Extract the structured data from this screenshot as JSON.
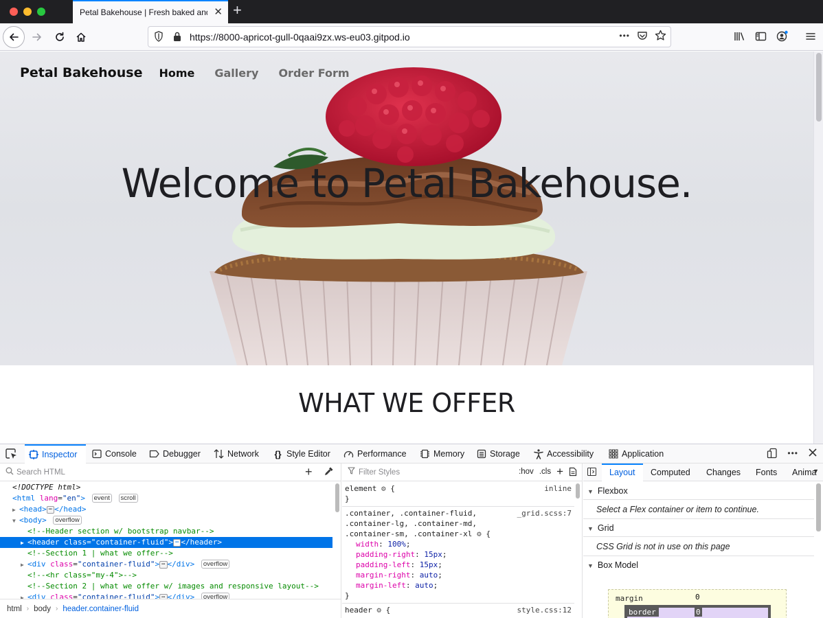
{
  "browser": {
    "tab_title": "Petal Bakehouse | Fresh baked and…",
    "tab_close": "✕",
    "new_tab": "+",
    "url": "https://8000-apricot-gull-0qaai9zx.ws-eu03.gitpod.io",
    "url_more": "•••"
  },
  "site": {
    "brand": "Petal Bakehouse",
    "nav": [
      "Home",
      "Gallery",
      "Order Form"
    ],
    "active_nav": "Home",
    "hero_title": "Welcome to Petal Bakehouse.",
    "section_title": "WHAT WE OFFER"
  },
  "devtools": {
    "tabs": [
      {
        "label": "Inspector",
        "icon": "inspector-icon"
      },
      {
        "label": "Console",
        "icon": "console-icon"
      },
      {
        "label": "Debugger",
        "icon": "debugger-icon"
      },
      {
        "label": "Network",
        "icon": "network-icon"
      },
      {
        "label": "Style Editor",
        "icon": "braces-icon"
      },
      {
        "label": "Performance",
        "icon": "gauge-icon"
      },
      {
        "label": "Memory",
        "icon": "memory-chip-icon"
      },
      {
        "label": "Storage",
        "icon": "storage-icon"
      },
      {
        "label": "Accessibility",
        "icon": "accessibility-icon"
      },
      {
        "label": "Application",
        "icon": "grid-dots-icon"
      }
    ],
    "selected_tab": "Inspector",
    "search_placeholder": "Search HTML",
    "markup": {
      "doctype": "<!DOCTYPE html>",
      "html_tag": "html",
      "html_attr": "lang",
      "html_val": "\"en\"",
      "badge_event": "event",
      "badge_scroll": "scroll",
      "head_tag": "head",
      "body_tag": "body",
      "badge_overflow": "overflow",
      "comment_header": "<!--Header section w/ bootstrap navbar-->",
      "header_tag": "header",
      "class_attr": "class",
      "header_class": "\"container-fluid\"",
      "comment_section1": "<!--Section 1 | what we offer-->",
      "div_tag": "div",
      "div_class": "\"container-fluid\"",
      "comment_hr": "<!--<hr class=\"my-4\">-->",
      "comment_section2": "<!--Section 2 | what we offer w/ images and responsive layout-->",
      "dots": "⋯"
    },
    "breadcrumbs": [
      "html",
      "body",
      "header.container-fluid"
    ],
    "filter_placeholder": "Filter Styles",
    "rules_toolbar": {
      "hov": ":hov",
      "cls": ".cls",
      "add": "+"
    },
    "rules": {
      "element_selector": "element",
      "element_src": "inline",
      "container_selector_1": ".container, .container-fluid,",
      "container_selector_2": ".container-lg, .container-md,",
      "container_selector_3": ".container-sm, .container-xl",
      "container_src": "_grid.scss:7",
      "props": [
        {
          "name": "width",
          "value": "100%"
        },
        {
          "name": "padding-right",
          "value": "15px"
        },
        {
          "name": "padding-left",
          "value": "15px"
        },
        {
          "name": "margin-right",
          "value": "auto"
        },
        {
          "name": "margin-left",
          "value": "auto"
        }
      ],
      "header_selector": "header",
      "header_src": "style.css:12",
      "open_brace": "{",
      "close_brace": "}"
    },
    "sidebar_tabs": [
      "Layout",
      "Computed",
      "Changes",
      "Fonts",
      "Anima"
    ],
    "selected_sidebar_tab": "Layout",
    "layout": {
      "flexbox_title": "Flexbox",
      "flexbox_msg": "Select a Flex container or item to continue.",
      "grid_title": "Grid",
      "grid_msg": "CSS Grid is not in use on this page",
      "boxmodel_title": "Box Model",
      "margin_label": "margin",
      "margin_value": "0",
      "border_label": "border",
      "border_value": "0"
    }
  }
}
